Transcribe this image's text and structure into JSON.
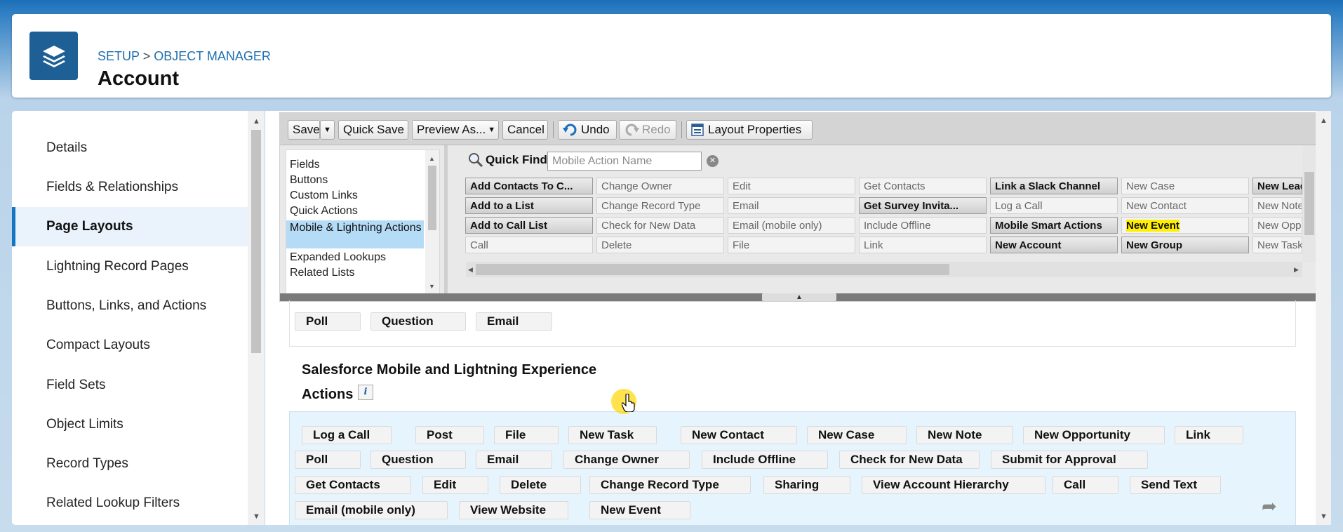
{
  "header": {
    "breadcrumb_setup": "SETUP",
    "breadcrumb_sep": ">",
    "breadcrumb_object_manager": "OBJECT MANAGER",
    "title": "Account"
  },
  "sidebar": {
    "items": [
      {
        "label": "Details"
      },
      {
        "label": "Fields & Relationships"
      },
      {
        "label": "Page Layouts",
        "active": true
      },
      {
        "label": "Lightning Record Pages"
      },
      {
        "label": "Buttons, Links, and Actions"
      },
      {
        "label": "Compact Layouts"
      },
      {
        "label": "Field Sets"
      },
      {
        "label": "Object Limits"
      },
      {
        "label": "Record Types"
      },
      {
        "label": "Related Lookup Filters"
      }
    ]
  },
  "toolbar": {
    "save": "Save",
    "save_dropdown": "▼",
    "quick_save": "Quick Save",
    "preview_as": "Preview As...",
    "preview_dropdown": "▼",
    "cancel": "Cancel",
    "undo": "Undo",
    "redo": "Redo",
    "layout_properties": "Layout Properties"
  },
  "palette": {
    "categories": [
      "Fields",
      "Buttons",
      "Custom Links",
      "Quick Actions",
      "Mobile & Lightning Actions",
      "Expanded Lookups",
      "Related Lists"
    ],
    "selected_category": "Mobile & Lightning Actions",
    "quick_find_label": "Quick Find",
    "quick_find_placeholder": "Mobile Action Name",
    "clear": "✕",
    "items": [
      [
        "Add Contacts To C...",
        "Change Owner",
        "Edit",
        "Get Contacts",
        "Link a Slack Channel",
        "New Case",
        "New Lead"
      ],
      [
        "Add to a List",
        "Change Record Type",
        "Email",
        "Get Survey Invita...",
        "Log a Call",
        "New Contact",
        "New Note"
      ],
      [
        "Add to Call List",
        "Check for New Data",
        "Email (mobile only)",
        "Include Offline",
        "Mobile Smart Actions",
        "New Event",
        "New Opportunity"
      ],
      [
        "Call",
        "Delete",
        "File",
        "Link",
        "New Account",
        "New Group",
        "New Task"
      ]
    ],
    "used_items": [
      "Add Contacts To C...",
      "Add to a List",
      "Add to Call List",
      "Get Survey Invita...",
      "Link a Slack Channel",
      "Mobile Smart Actions",
      "New Account",
      "New Group",
      "New Lead"
    ],
    "highlighted_item": "New Event"
  },
  "layout": {
    "upper_actions": [
      "Poll",
      "Question",
      "Email"
    ],
    "section_title_line1": "Salesforce Mobile and Lightning Experience",
    "section_title_line2": "Actions",
    "info": "i",
    "actions": [
      "Log a Call",
      "Post",
      "File",
      "New Task",
      "New Contact",
      "New Case",
      "New Note",
      "New Opportunity",
      "Link",
      "Poll",
      "Question",
      "Email",
      "Change Owner",
      "Include Offline",
      "Check for New Data",
      "Submit for Approval",
      "Get Contacts",
      "Edit",
      "Delete",
      "Change Record Type",
      "Sharing",
      "View Account Hierarchy",
      "Call",
      "Send Text",
      "Email (mobile only)",
      "View Website",
      "New Event"
    ]
  },
  "icons": {
    "app": "layers-icon",
    "search": "magnifier-icon",
    "undo": "undo-arrow-icon",
    "redo": "redo-arrow-icon",
    "layout_properties": "properties-icon",
    "restore": "return-arrow-icon"
  },
  "colors": {
    "app_icon": "#1e6095",
    "active_nav": "#1276c3",
    "selected_category": "#b5dcf7",
    "highlight": "#ffef00",
    "drop_zone": "#e6f4fd"
  }
}
